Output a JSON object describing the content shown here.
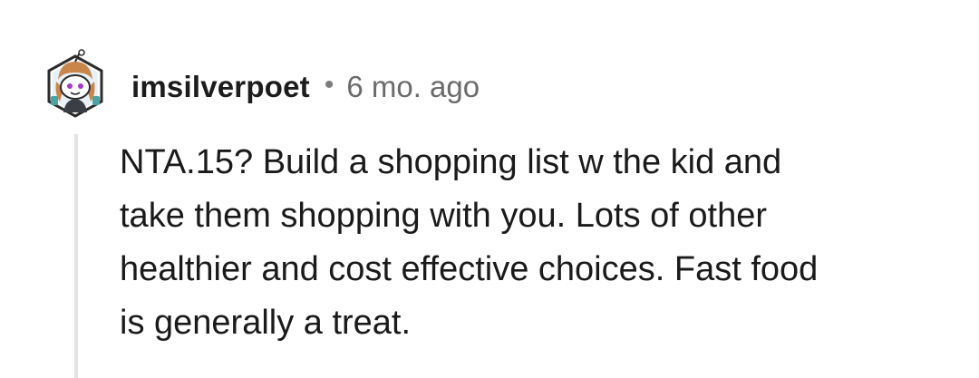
{
  "comment": {
    "username": "imsilverpoet",
    "separator": "•",
    "age": "6 mo. ago",
    "body_lines": [
      "NTA.15? Build a shopping list w the kid and",
      "take them shopping with you. Lots of other",
      "healthier and cost effective choices. Fast food",
      "is generally a treat."
    ],
    "avatar_icon": "snoo-avatar-icon"
  }
}
